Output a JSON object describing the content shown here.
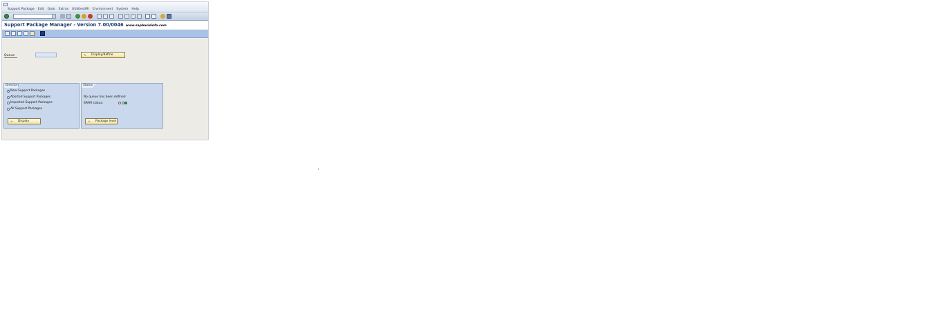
{
  "menu": {
    "items": [
      "Support Package",
      "Edit",
      "Goto",
      "Extras",
      "Utilities(M)",
      "Environment",
      "System",
      "Help"
    ]
  },
  "title": {
    "text": "Support Package Manager - Version 7.00/0046",
    "watermark": "www.sapbasisinfo.com"
  },
  "queue": {
    "label": "Queue",
    "value": "",
    "button_label": "Display/define"
  },
  "directory": {
    "title": "Directory",
    "options": [
      {
        "label": "New Support Packages",
        "checked": true
      },
      {
        "label": "Aborted Support Packages",
        "checked": false
      },
      {
        "label": "Imported Support Packages",
        "checked": false
      },
      {
        "label": "All Support Packages",
        "checked": false
      }
    ],
    "button_label": "Display"
  },
  "status": {
    "title": "Status",
    "message": "No queue has been defined",
    "spam_label": "SPAM status:",
    "spam_lights": [
      "off",
      "off",
      "green"
    ],
    "button_label": "Package level"
  }
}
